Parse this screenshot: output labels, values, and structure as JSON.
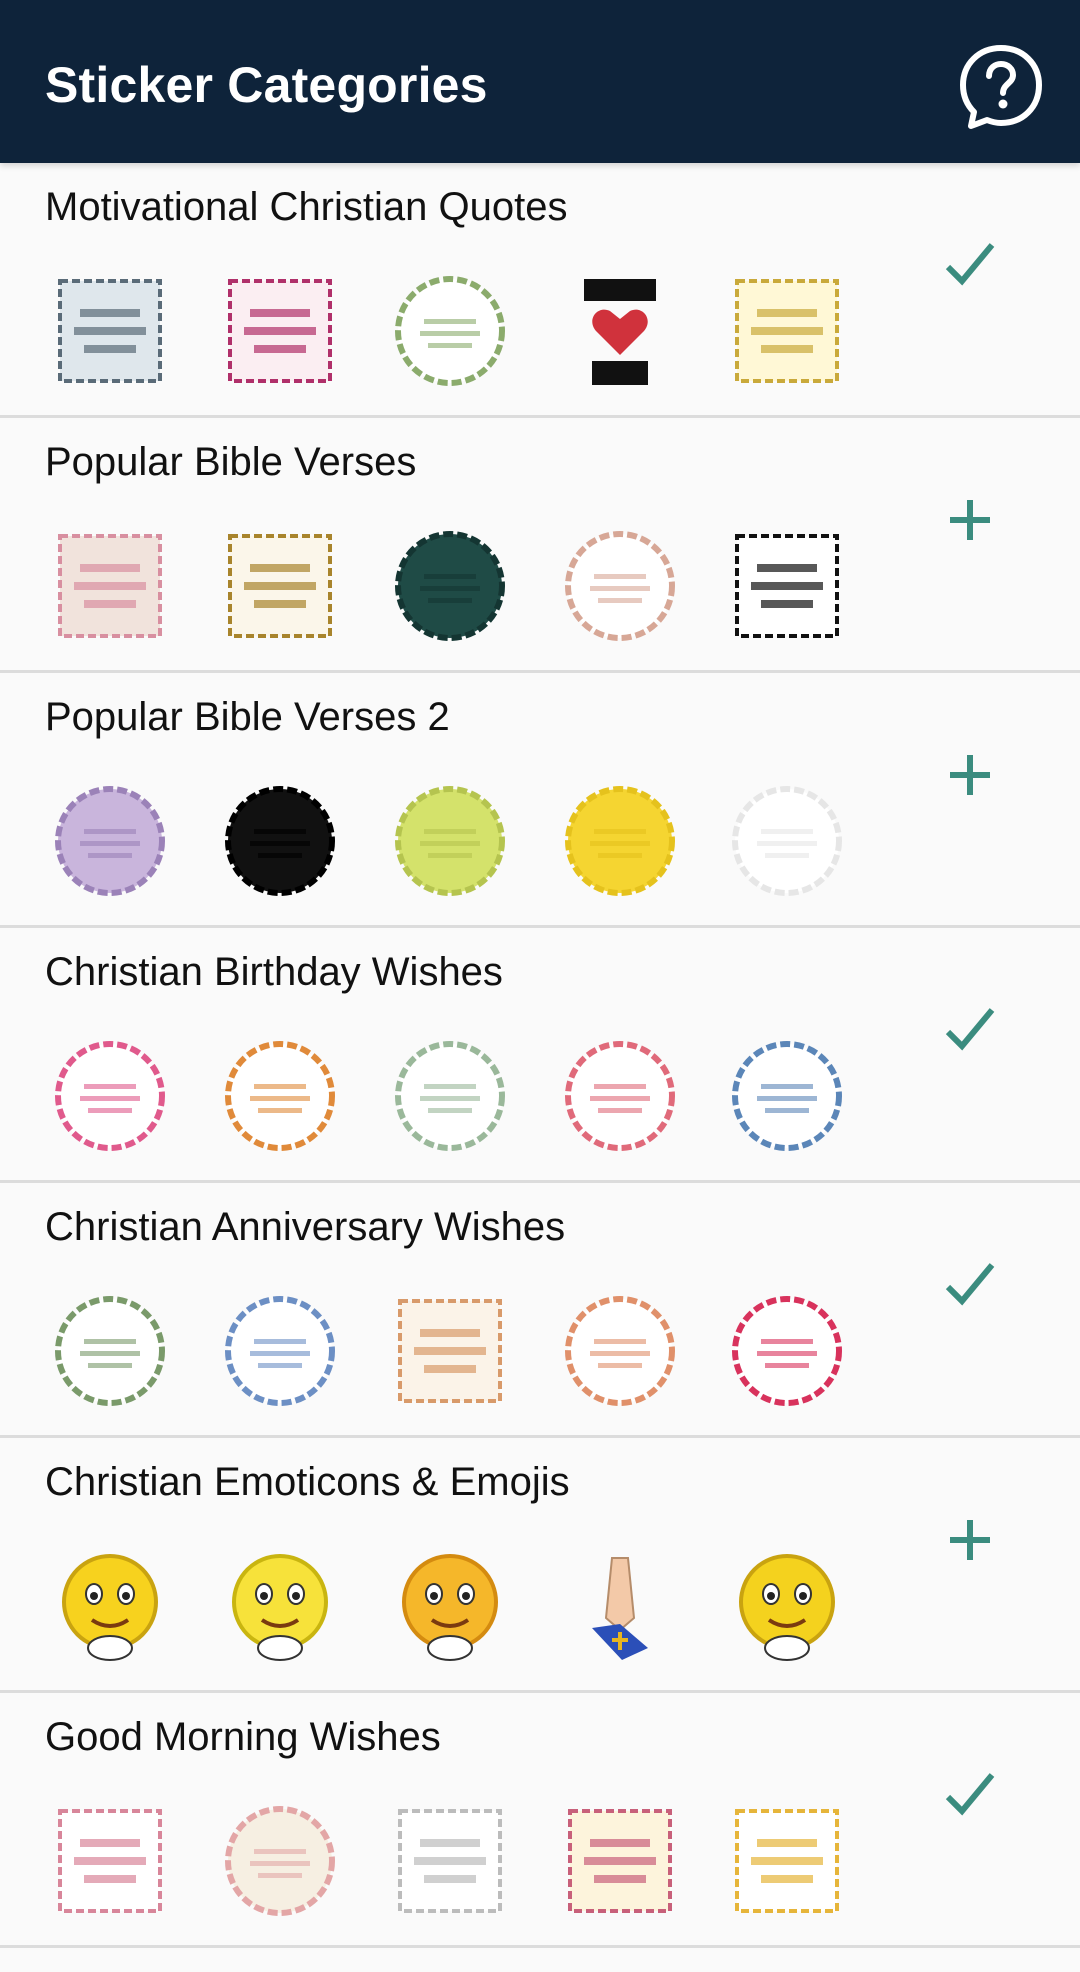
{
  "app_bar": {
    "title": "Sticker Categories",
    "help_icon": "help-chat-bubble-icon"
  },
  "accent_color": "#3b8c7f",
  "header_color": "#0e233a",
  "categories": [
    {
      "name": "Motivational Christian Quotes",
      "status": "added",
      "stickers": [
        {
          "shape": "square",
          "bg": "#dfe7ec",
          "ring": "#5a6b78"
        },
        {
          "shape": "square",
          "bg": "#fbeef2",
          "ring": "#b0306a"
        },
        {
          "shape": "circle",
          "bg": "#ffffff",
          "ring": "#8bab6c"
        },
        {
          "shape": "heart",
          "bg": "#ffffff",
          "ring": "#d0323c"
        },
        {
          "shape": "square",
          "bg": "#fff8d6",
          "ring": "#c9a93a"
        }
      ]
    },
    {
      "name": "Popular Bible Verses",
      "status": "not-added",
      "stickers": [
        {
          "shape": "square",
          "bg": "#f1e3dc",
          "ring": "#d88fa0"
        },
        {
          "shape": "square",
          "bg": "#fbf6ea",
          "ring": "#a8842c"
        },
        {
          "shape": "circle",
          "bg": "#1f4b46",
          "ring": "#143532"
        },
        {
          "shape": "circle",
          "bg": "#ffffff",
          "ring": "#d7a796"
        },
        {
          "shape": "square",
          "bg": "#ffffff",
          "ring": "#111111"
        }
      ]
    },
    {
      "name": "Popular Bible Verses 2",
      "status": "not-added",
      "stickers": [
        {
          "shape": "circle",
          "bg": "#c9b5dc",
          "ring": "#9b82b8"
        },
        {
          "shape": "circle",
          "bg": "#111111",
          "ring": "#000000"
        },
        {
          "shape": "circle",
          "bg": "#d4e26b",
          "ring": "#b5c44f"
        },
        {
          "shape": "circle",
          "bg": "#f5d531",
          "ring": "#e5c21d"
        },
        {
          "shape": "circle",
          "bg": "#ffffff",
          "ring": "#e6e6e6"
        }
      ]
    },
    {
      "name": "Christian Birthday Wishes",
      "status": "added",
      "stickers": [
        {
          "shape": "circle",
          "bg": "#ffffff",
          "ring": "#e05a8c"
        },
        {
          "shape": "circle",
          "bg": "#ffffff",
          "ring": "#e08a3a"
        },
        {
          "shape": "circle",
          "bg": "#ffffff",
          "ring": "#9ab89a"
        },
        {
          "shape": "circle",
          "bg": "#ffffff",
          "ring": "#e06a7a"
        },
        {
          "shape": "circle",
          "bg": "#ffffff",
          "ring": "#5b86b8"
        }
      ]
    },
    {
      "name": "Christian Anniversary Wishes",
      "status": "added",
      "stickers": [
        {
          "shape": "circle",
          "bg": "#ffffff",
          "ring": "#7a9a6a"
        },
        {
          "shape": "circle",
          "bg": "#ffffff",
          "ring": "#6c8fc4"
        },
        {
          "shape": "square",
          "bg": "#fbf3e8",
          "ring": "#d89a6a"
        },
        {
          "shape": "circle",
          "bg": "#ffffff",
          "ring": "#e0906a"
        },
        {
          "shape": "circle",
          "bg": "#ffffff",
          "ring": "#d8325c"
        }
      ]
    },
    {
      "name": "Christian Emoticons & Emojis",
      "status": "not-added",
      "stickers": [
        {
          "shape": "emoji",
          "bg": "#f7d21e",
          "ring": "#c9a310"
        },
        {
          "shape": "emoji",
          "bg": "#f7e23a",
          "ring": "#c9b510"
        },
        {
          "shape": "emoji",
          "bg": "#f5b72a",
          "ring": "#d48b10"
        },
        {
          "shape": "hands",
          "bg": "#f3c9a8",
          "ring": "#2b4fb8"
        },
        {
          "shape": "emoji",
          "bg": "#f4d21e",
          "ring": "#c9a310"
        }
      ]
    },
    {
      "name": "Good Morning Wishes",
      "status": "added",
      "stickers": [
        {
          "shape": "square",
          "bg": "#ffffff",
          "ring": "#d8869a"
        },
        {
          "shape": "circle",
          "bg": "#f6efe2",
          "ring": "#e3a6a6"
        },
        {
          "shape": "square",
          "bg": "#ffffff",
          "ring": "#bcbcbc"
        },
        {
          "shape": "square",
          "bg": "#fdf4dc",
          "ring": "#c8607a"
        },
        {
          "shape": "square",
          "bg": "#ffffff",
          "ring": "#e6b53a"
        }
      ]
    }
  ]
}
